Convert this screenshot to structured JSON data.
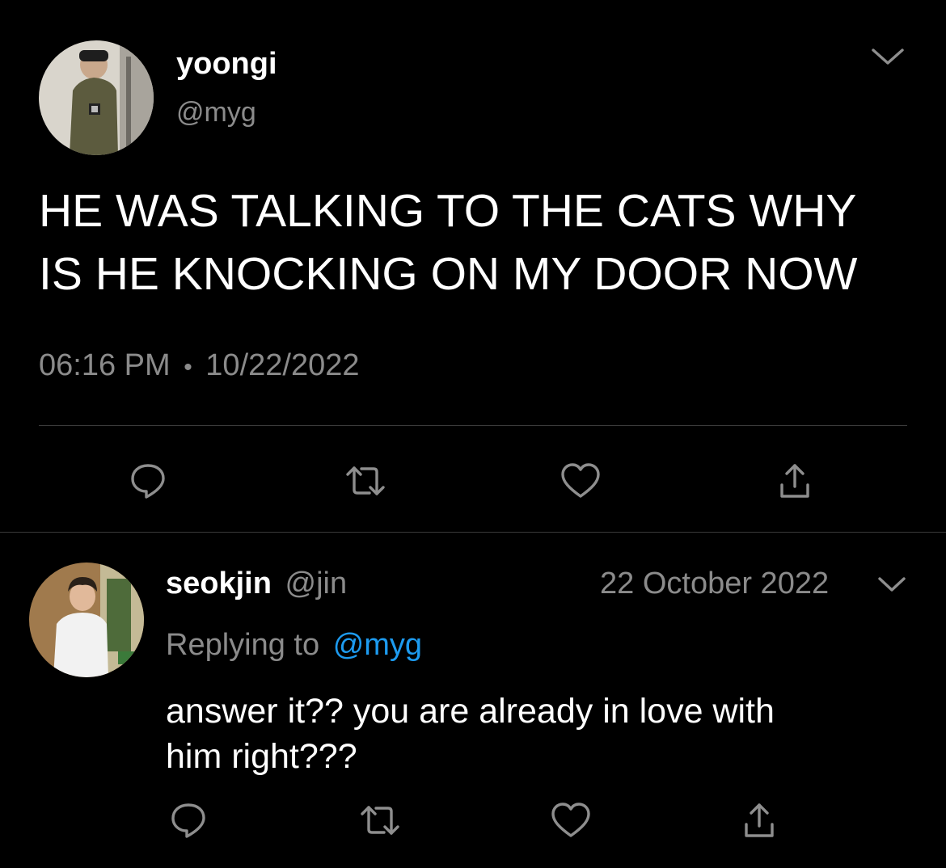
{
  "main_tweet": {
    "display_name": "yoongi",
    "handle": "@myg",
    "text_line1": "HE WAS TALKING TO THE CATS WHY",
    "text_line2": "IS HE KNOCKING ON MY DOOR NOW",
    "time": "06:16 PM",
    "separator": "•",
    "date": "10/22/2022",
    "avatar_icon": "user-avatar-photo",
    "menu_icon": "chevron-down-icon",
    "actions": [
      "reply-icon",
      "retweet-icon",
      "like-icon",
      "share-icon"
    ]
  },
  "reply_tweet": {
    "display_name": "seokjin",
    "handle": "@jin",
    "date": "22 October 2022",
    "replying_prefix": "Replying to",
    "replying_handle": "@myg",
    "text_line1": "answer it?? you are already in love with",
    "text_line2": "him right???",
    "avatar_icon": "user-avatar-photo",
    "menu_icon": "chevron-down-icon",
    "actions": [
      "reply-icon",
      "retweet-icon",
      "like-icon",
      "share-icon"
    ]
  },
  "colors": {
    "background": "#000000",
    "text": "#ffffff",
    "muted": "#8b8b8b",
    "link": "#1d9bf0",
    "divider": "#3a3a3a"
  }
}
